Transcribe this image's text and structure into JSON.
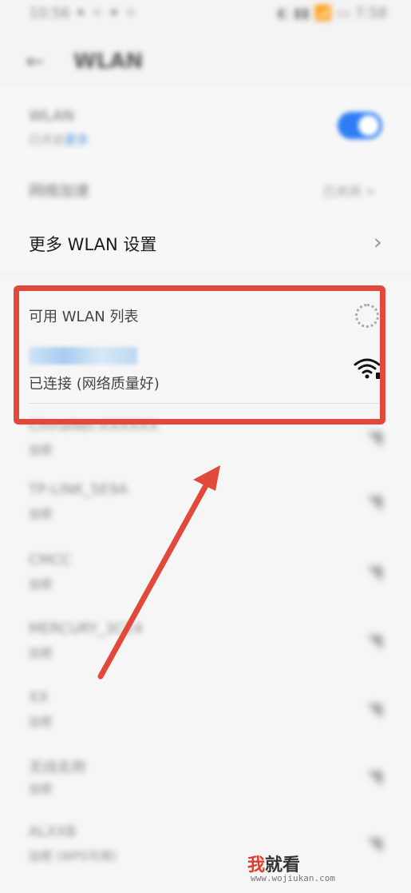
{
  "status_bar": {
    "left": "10:56 ✦ ✧ ✦ ✧",
    "right": "◐ ▮▮ 📶 ▭ 7:58"
  },
  "header": {
    "title": "WLAN",
    "back_icon": "back-arrow-icon"
  },
  "settings": {
    "wlan_label": "WLAN",
    "wlan_sub": "已开启",
    "wlan_sub_link": "更多",
    "network_select_label": "网络加速",
    "network_select_value": "已关闭 >",
    "more_label": "更多 WLAN 设置",
    "more_chevron": "›"
  },
  "wlan_list": {
    "title": "可用 WLAN 列表",
    "connected": {
      "status": "已连接 (网络质量好)"
    },
    "networks": [
      {
        "name": "ChinaNet-XXXXXX",
        "sub": "加密"
      },
      {
        "name": "TP-LINK_5E9A",
        "sub": "加密"
      },
      {
        "name": "CMCC",
        "sub": "加密"
      },
      {
        "name": "MERCURY_3C24",
        "sub": "加密"
      },
      {
        "name": "XX",
        "sub": "加密"
      },
      {
        "name": "无线名称",
        "sub": "加密"
      },
      {
        "name": "ALXXB",
        "sub": "加密 (WPS可用)"
      }
    ]
  },
  "watermark": {
    "cn_red": "我",
    "cn_dark": "就看",
    "url": "www.wojiukan.com"
  },
  "colors": {
    "accent": "#2f7df6",
    "highlight": "#e14a3b"
  }
}
